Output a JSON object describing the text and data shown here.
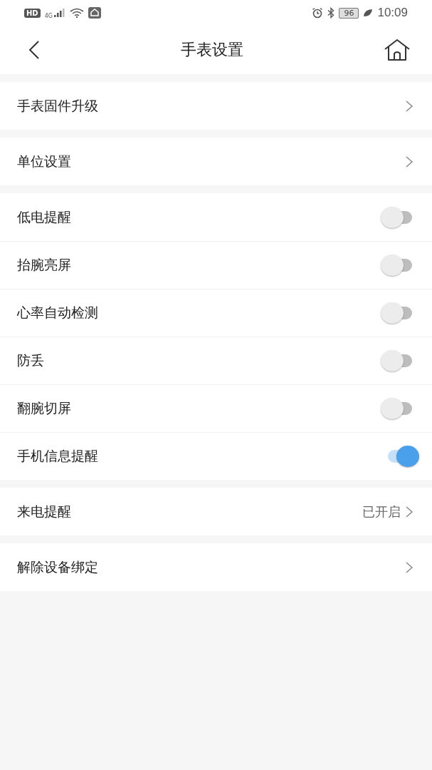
{
  "status_bar": {
    "hd": "HD",
    "network": "4G",
    "battery": "96",
    "time": "10:09"
  },
  "header": {
    "title": "手表设置"
  },
  "groups": [
    {
      "items": [
        {
          "kind": "link",
          "label": "手表固件升级"
        }
      ]
    },
    {
      "items": [
        {
          "kind": "link",
          "label": "单位设置"
        }
      ]
    },
    {
      "items": [
        {
          "kind": "toggle",
          "label": "低电提醒",
          "on": false
        },
        {
          "kind": "toggle",
          "label": "抬腕亮屏",
          "on": false
        },
        {
          "kind": "toggle",
          "label": "心率自动检测",
          "on": false
        },
        {
          "kind": "toggle",
          "label": "防丢",
          "on": false
        },
        {
          "kind": "toggle",
          "label": "翻腕切屏",
          "on": false
        },
        {
          "kind": "toggle",
          "label": "手机信息提醒",
          "on": true
        }
      ]
    },
    {
      "items": [
        {
          "kind": "link",
          "label": "来电提醒",
          "value": "已开启"
        }
      ]
    },
    {
      "items": [
        {
          "kind": "link",
          "label": "解除设备绑定"
        }
      ]
    }
  ]
}
